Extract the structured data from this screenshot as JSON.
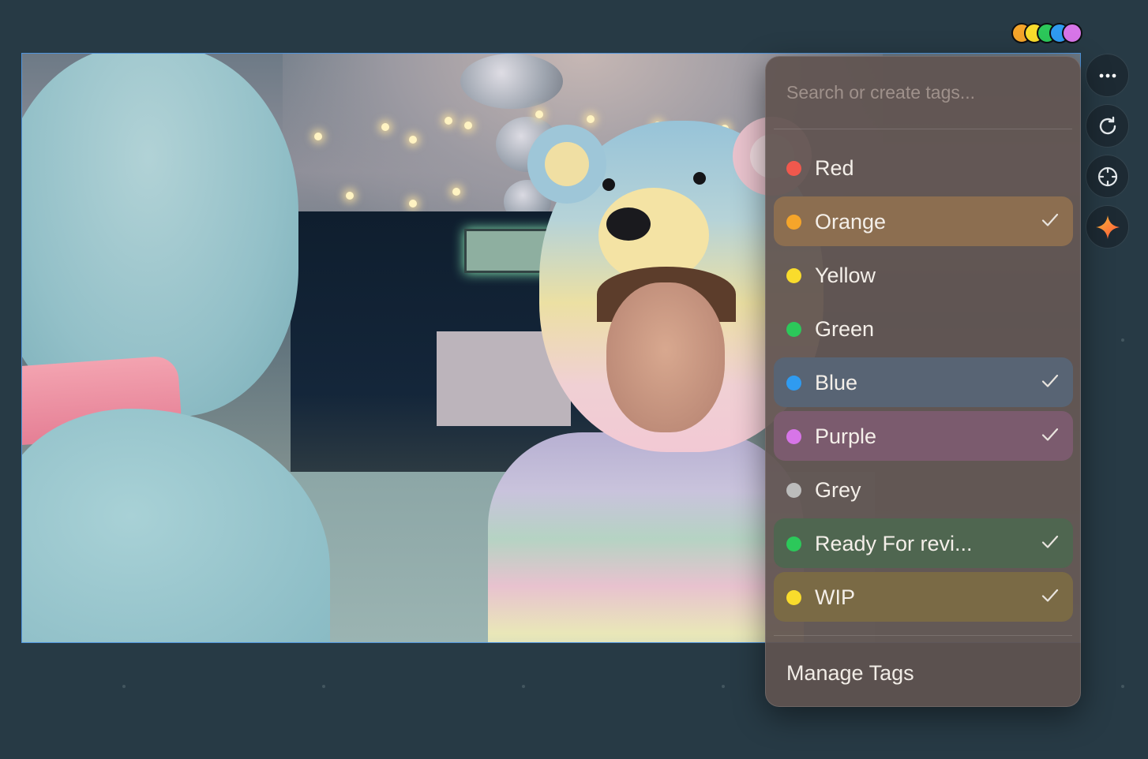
{
  "search": {
    "placeholder": "Search or create tags..."
  },
  "tags": [
    {
      "label": "Red",
      "color": "#f0584d",
      "checked": false,
      "highlight": ""
    },
    {
      "label": "Orange",
      "color": "#f5a52a",
      "checked": true,
      "highlight": "#8c6e50"
    },
    {
      "label": "Yellow",
      "color": "#f9dc2c",
      "checked": false,
      "highlight": ""
    },
    {
      "label": "Green",
      "color": "#2cc85a",
      "checked": false,
      "highlight": ""
    },
    {
      "label": "Blue",
      "color": "#2f9bf0",
      "checked": true,
      "highlight": "#586474"
    },
    {
      "label": "Purple",
      "color": "#d775e8",
      "checked": true,
      "highlight": "#7b5b6e"
    },
    {
      "label": "Grey",
      "color": "#bcbcbc",
      "checked": false,
      "highlight": ""
    },
    {
      "label": "Ready For revi...",
      "color": "#2cc85a",
      "checked": true,
      "highlight": "#4f6650"
    },
    {
      "label": "WIP",
      "color": "#f9dc2c",
      "checked": true,
      "highlight": "#7a6a45"
    }
  ],
  "footer": {
    "manage_label": "Manage Tags"
  },
  "toolbar": {
    "more_icon": "more-icon",
    "refresh_icon": "refresh-icon",
    "crosshair_icon": "crosshair-icon",
    "sparkle_icon": "sparkle-icon"
  },
  "tag_color_stack": [
    "#f5a52a",
    "#f9dc2c",
    "#2cc85a",
    "#2f9bf0",
    "#d775e8"
  ]
}
